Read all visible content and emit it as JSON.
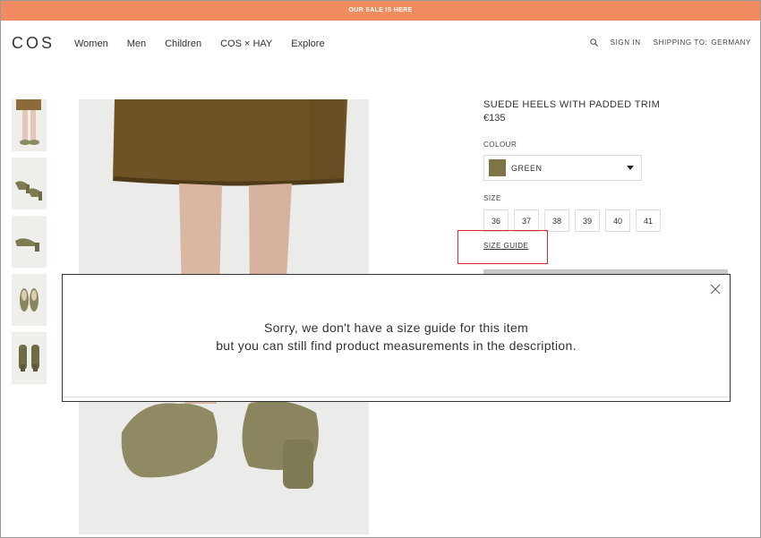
{
  "promo": {
    "text": "OUR SALE IS HERE"
  },
  "header": {
    "logo": "COS",
    "nav": [
      "Women",
      "Men",
      "Children",
      "COS × HAY",
      "Explore"
    ],
    "search_icon": "search-icon",
    "sign_in": "SIGN IN",
    "shipping_label": "SHIPPING TO:",
    "shipping_country": "GERMANY"
  },
  "product": {
    "title": "SUEDE HEELS WITH PADDED TRIM",
    "price": "€135",
    "colour_label": "COLOUR",
    "colour_value": "GREEN",
    "swatch_color": "#7f7448",
    "size_label": "SIZE",
    "sizes": [
      "36",
      "37",
      "38",
      "39",
      "40",
      "41"
    ],
    "size_guide": "SIZE GUIDE"
  },
  "modal": {
    "line1": "Sorry, we don't have a size guide for this item",
    "line2": "but you can still find product measurements in the description.",
    "close_icon": "close-icon"
  },
  "colors": {
    "promo_bg": "#f08c5f",
    "highlight": "#d9282b"
  }
}
